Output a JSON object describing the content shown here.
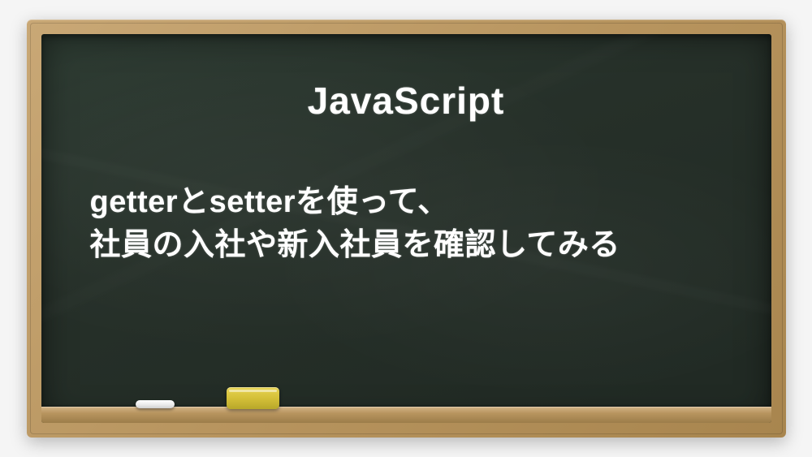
{
  "title": "JavaScript",
  "body_line1": "getterとsetterを使って、",
  "body_line2": "社員の入社や新入社員を確認してみる"
}
